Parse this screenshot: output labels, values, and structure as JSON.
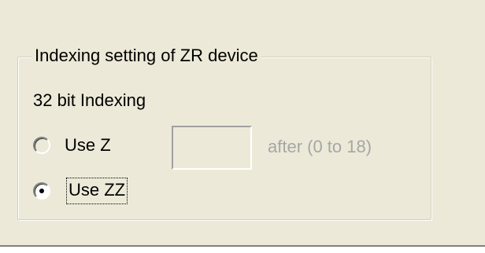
{
  "groupbox": {
    "title": "Indexing setting of ZR device",
    "subtitle": "32 bit Indexing",
    "options": [
      {
        "label": "Use Z",
        "selected": false
      },
      {
        "label": "Use ZZ",
        "selected": true
      }
    ],
    "z_input": {
      "value": ""
    },
    "after_label": "after (0 to 18)"
  }
}
